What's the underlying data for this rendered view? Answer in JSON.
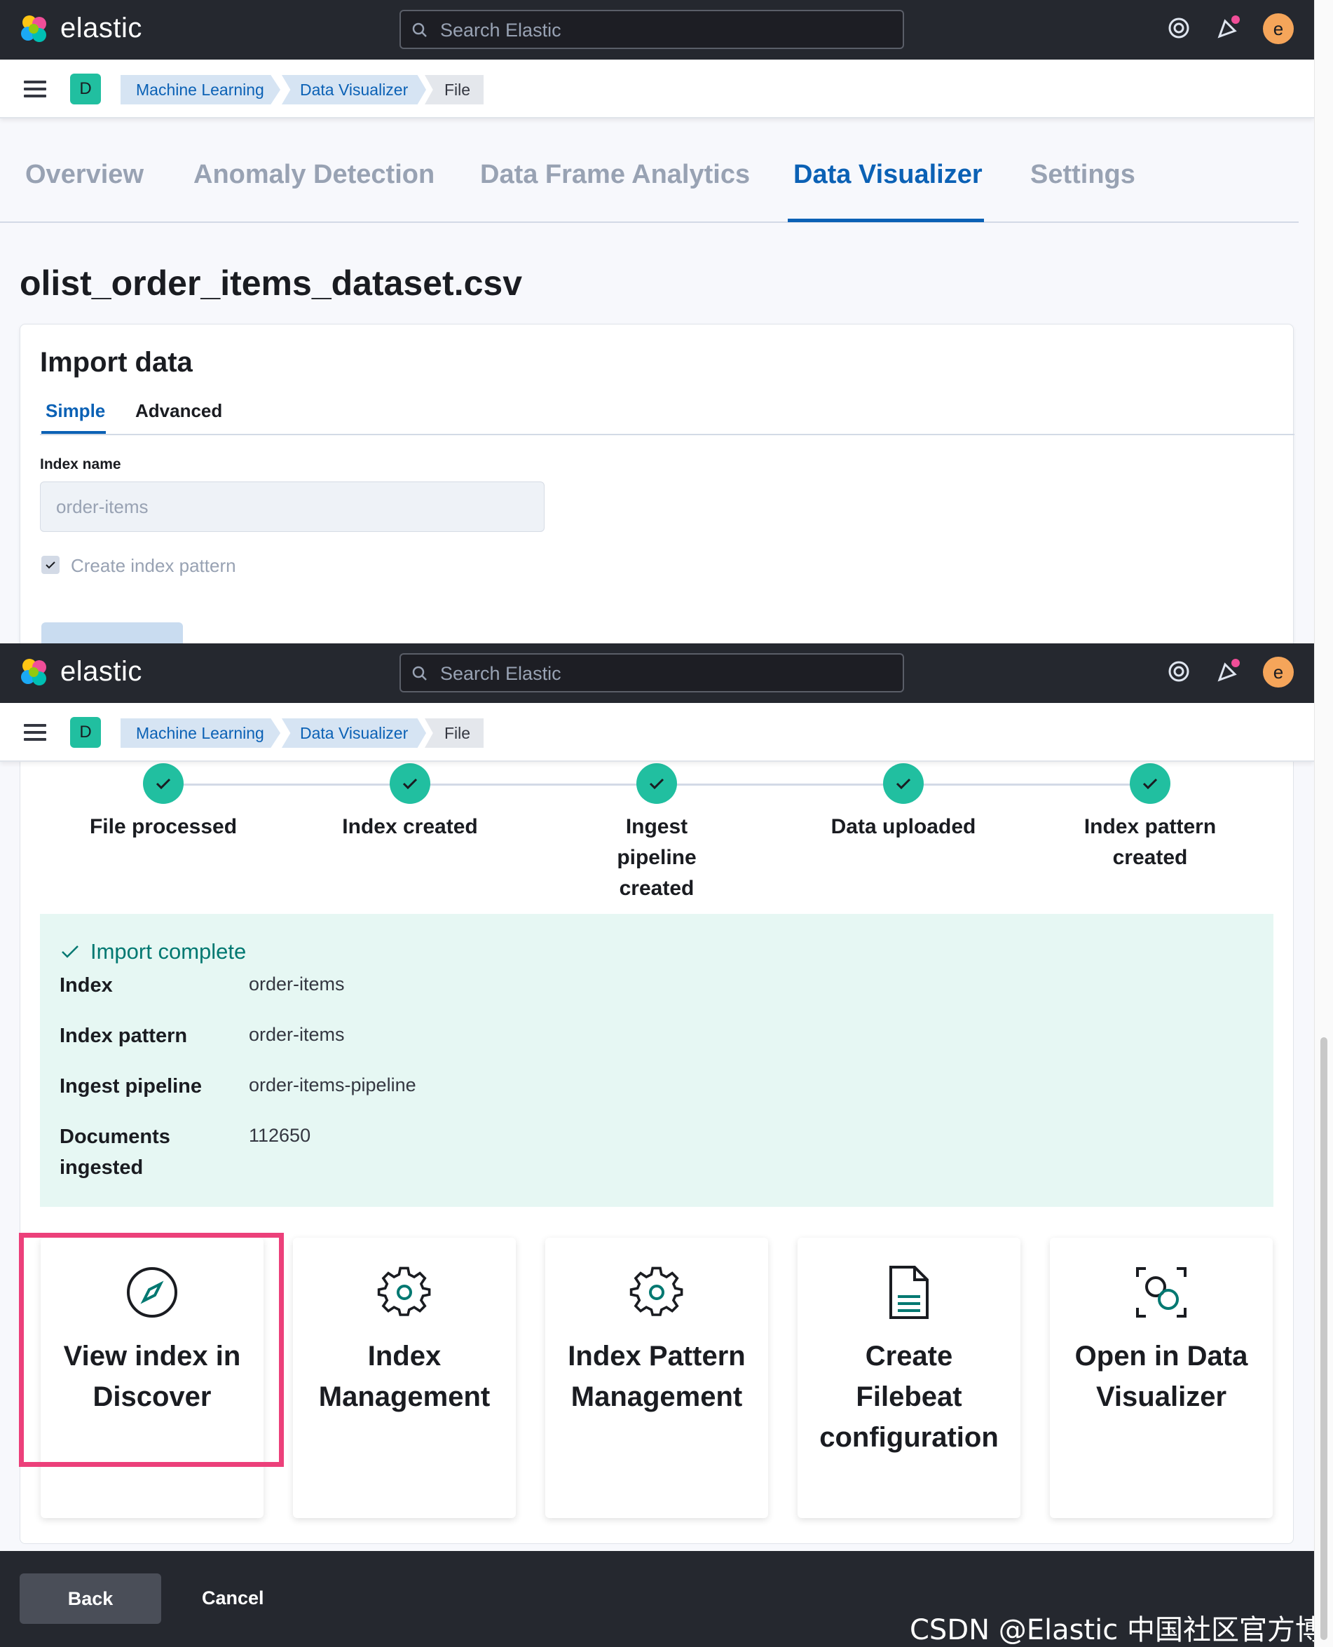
{
  "header": {
    "logo_text": "elastic",
    "search_placeholder": "Search Elastic",
    "avatar_letter": "e"
  },
  "breadcrumbs": {
    "space_badge": "D",
    "items": [
      "Machine Learning",
      "Data Visualizer",
      "File"
    ]
  },
  "tabs": [
    "Overview",
    "Anomaly Detection",
    "Data Frame Analytics",
    "Data Visualizer",
    "Settings"
  ],
  "active_tab": "Data Visualizer",
  "file_title": "olist_order_items_dataset.csv",
  "import_panel": {
    "title": "Import data",
    "subtabs": [
      "Simple",
      "Advanced"
    ],
    "index_name_label": "Index name",
    "index_name_value": "order-items",
    "create_index_pattern_label": "Create index pattern",
    "create_index_pattern_checked": true
  },
  "steps": [
    {
      "label": "File processed"
    },
    {
      "label": "Index created"
    },
    {
      "label": "Ingest pipeline created"
    },
    {
      "label": "Data uploaded"
    },
    {
      "label": "Index pattern created"
    }
  ],
  "import_result": {
    "title": "Import complete",
    "rows": [
      {
        "key": "Index",
        "value": "order-items"
      },
      {
        "key": "Index pattern",
        "value": "order-items"
      },
      {
        "key": "Ingest pipeline",
        "value": "order-items-pipeline"
      },
      {
        "key": "Documents ingested",
        "value": "112650"
      }
    ]
  },
  "actions": [
    {
      "label": "View index in Discover",
      "icon": "compass-icon"
    },
    {
      "label": "Index Management",
      "icon": "gear-icon"
    },
    {
      "label": "Index Pattern Management",
      "icon": "gear-icon"
    },
    {
      "label": "Create Filebeat configuration",
      "icon": "document-icon"
    },
    {
      "label": "Open in Data Visualizer",
      "icon": "visualizer-icon"
    }
  ],
  "footer": {
    "back_label": "Back",
    "cancel_label": "Cancel"
  },
  "watermark": "CSDN @Elastic 中国社区官方博客",
  "colors": {
    "accent": "#0b61b5",
    "success": "#21bfa0",
    "highlight": "#ec407a",
    "header": "#25282f"
  }
}
